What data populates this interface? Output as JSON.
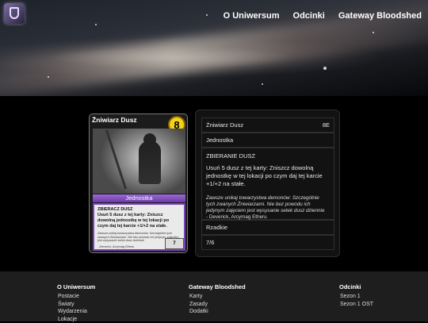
{
  "header": {
    "nav": [
      "O Uniwersum",
      "Odcinki",
      "Gateway Bloodshed"
    ]
  },
  "card": {
    "name": "Żniwiarz Dusz",
    "cost": "8",
    "type": "Jednostka",
    "ability_title": "ZBIERACZ DUSZ",
    "ability_text": "Usuń 5 dusz z tej karty: Zniszcz dowolną jednostkę w tej lokacji po czym daj tej karcie +1/+2 na stałe.",
    "flavor": "Zawsze unikaj towarzystwa demonów: Szczególnie tych zwanych Żniwiarzami. Nie bez powodu ich jedynym zajęciem jest wysysanie setek dusz dziennie",
    "author": "- Deverick, Arcymag Etheru",
    "set_badge": "7"
  },
  "details": {
    "name": "Żniwiarz Dusz",
    "cost": "8E",
    "type": "Jednostka",
    "ability_title": "ZBIERANIE DUSZ",
    "ability_text": "Usuń 5 dusz z tej karty: Zniszcz dowolną jednostkę w tej lokacji po czym daj tej karcie +1/+2 na stałe.",
    "flavor": "Zawsze unikaj towarzystwa demonów: Szczególnie tych zwanych Żniwiarzami. Nie bez powodu ich jedynym zajęciem jest wysysanie setek dusz dziennie",
    "author": "- Deverick, Arcymag Etheru",
    "rarity": "Rzadkie",
    "number": "7/6"
  },
  "footer": {
    "col1": {
      "title": "O Uniwersum",
      "links": [
        "Postacie",
        "Światy",
        "Wydarzenia",
        "Lokacje"
      ]
    },
    "col2": {
      "title": "Gateway Bloodshed",
      "links": [
        "Karty",
        "Zasady",
        "Dodatki"
      ]
    },
    "col3": {
      "title": "Odcinki",
      "links": [
        "Sezon 1",
        "Sezon 1 OST"
      ]
    }
  },
  "colors": {
    "cost_badge": "#f2d21b",
    "type_banner": "#7a46b8",
    "footer_bg": "#1e1e1e"
  }
}
